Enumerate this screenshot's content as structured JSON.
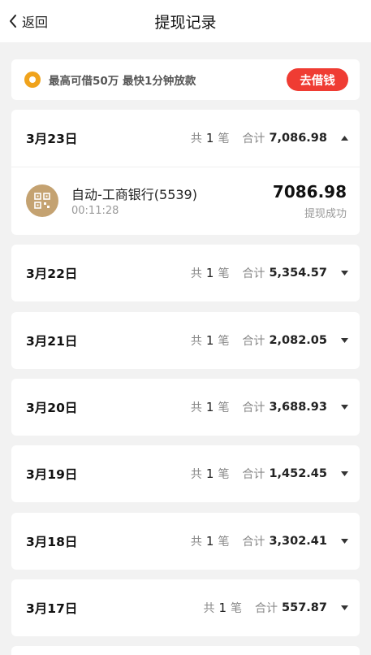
{
  "header": {
    "back_label": "返回",
    "title": "提现记录"
  },
  "banner": {
    "icon": "coin-icon",
    "text": "最高可借50万  最快1分钟放款",
    "button_label": "去借钱",
    "accent_color": "#ef3c33"
  },
  "records": [
    {
      "date": "3月23日",
      "count_prefix": "共",
      "count": "1",
      "count_unit": "笔",
      "total_label": "合计",
      "total": "7,086.98",
      "expanded": true,
      "items": [
        {
          "icon": "qr-code-icon",
          "name": "自动-工商银行(5539)",
          "time": "00:11:28",
          "amount": "7086.98",
          "status": "提现成功"
        }
      ]
    },
    {
      "date": "3月22日",
      "count_prefix": "共",
      "count": "1",
      "count_unit": "笔",
      "total_label": "合计",
      "total": "5,354.57",
      "expanded": false
    },
    {
      "date": "3月21日",
      "count_prefix": "共",
      "count": "1",
      "count_unit": "笔",
      "total_label": "合计",
      "total": "2,082.05",
      "expanded": false
    },
    {
      "date": "3月20日",
      "count_prefix": "共",
      "count": "1",
      "count_unit": "笔",
      "total_label": "合计",
      "total": "3,688.93",
      "expanded": false
    },
    {
      "date": "3月19日",
      "count_prefix": "共",
      "count": "1",
      "count_unit": "笔",
      "total_label": "合计",
      "total": "1,452.45",
      "expanded": false
    },
    {
      "date": "3月18日",
      "count_prefix": "共",
      "count": "1",
      "count_unit": "笔",
      "total_label": "合计",
      "total": "3,302.41",
      "expanded": false
    },
    {
      "date": "3月17日",
      "count_prefix": "共",
      "count": "1",
      "count_unit": "笔",
      "total_label": "合计",
      "total": "557.87",
      "expanded": false
    }
  ]
}
